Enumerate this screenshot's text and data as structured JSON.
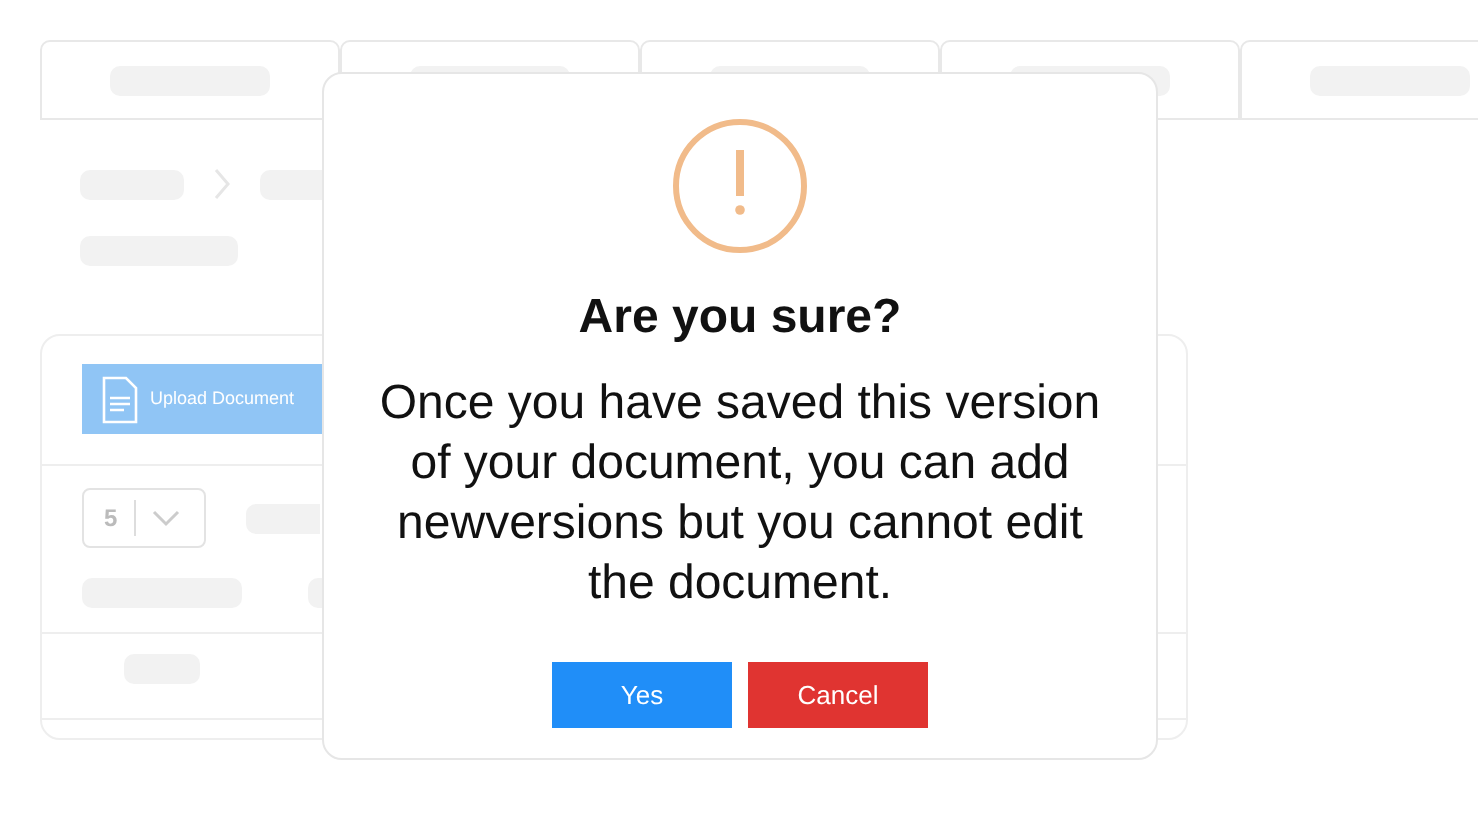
{
  "background": {
    "upload_button": "Upload Document",
    "page_size": "5"
  },
  "dialog": {
    "title": "Are you sure?",
    "message": "Once you have saved this version of your document, you can add newversions but you cannot edit the document.",
    "buttons": [
      {
        "label": "Yes",
        "kind": "confirm"
      },
      {
        "label": "Cancel",
        "kind": "cancel"
      }
    ]
  }
}
